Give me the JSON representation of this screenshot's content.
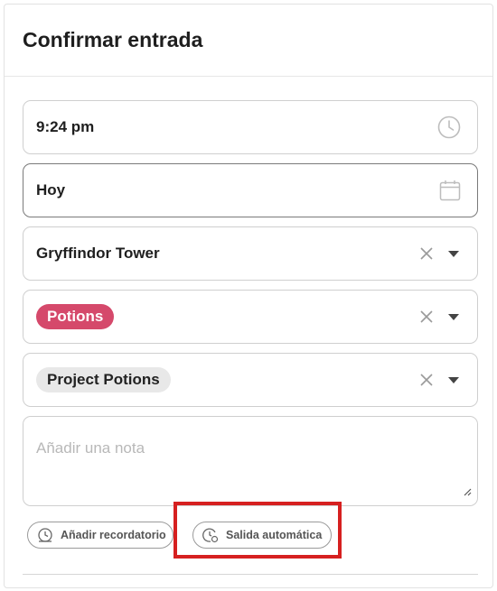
{
  "dialog": {
    "title": "Confirmar entrada"
  },
  "fields": {
    "time": {
      "value": "9:24 pm",
      "icon": "clock-icon"
    },
    "date": {
      "value": "Hoy",
      "icon": "calendar-icon"
    },
    "location": {
      "value": "Gryffindor Tower"
    },
    "tag": {
      "value": "Potions",
      "color": "#d5496b"
    },
    "project": {
      "value": "Project Potions"
    },
    "note": {
      "placeholder": "Añadir una nota"
    }
  },
  "actions": {
    "reminder_label": "Añadir recordatorio",
    "auto_checkout_label": "Salida automática"
  },
  "colors": {
    "tag_pink": "#d5496b",
    "highlight_red": "#d62020",
    "border": "#cfcfcf"
  }
}
